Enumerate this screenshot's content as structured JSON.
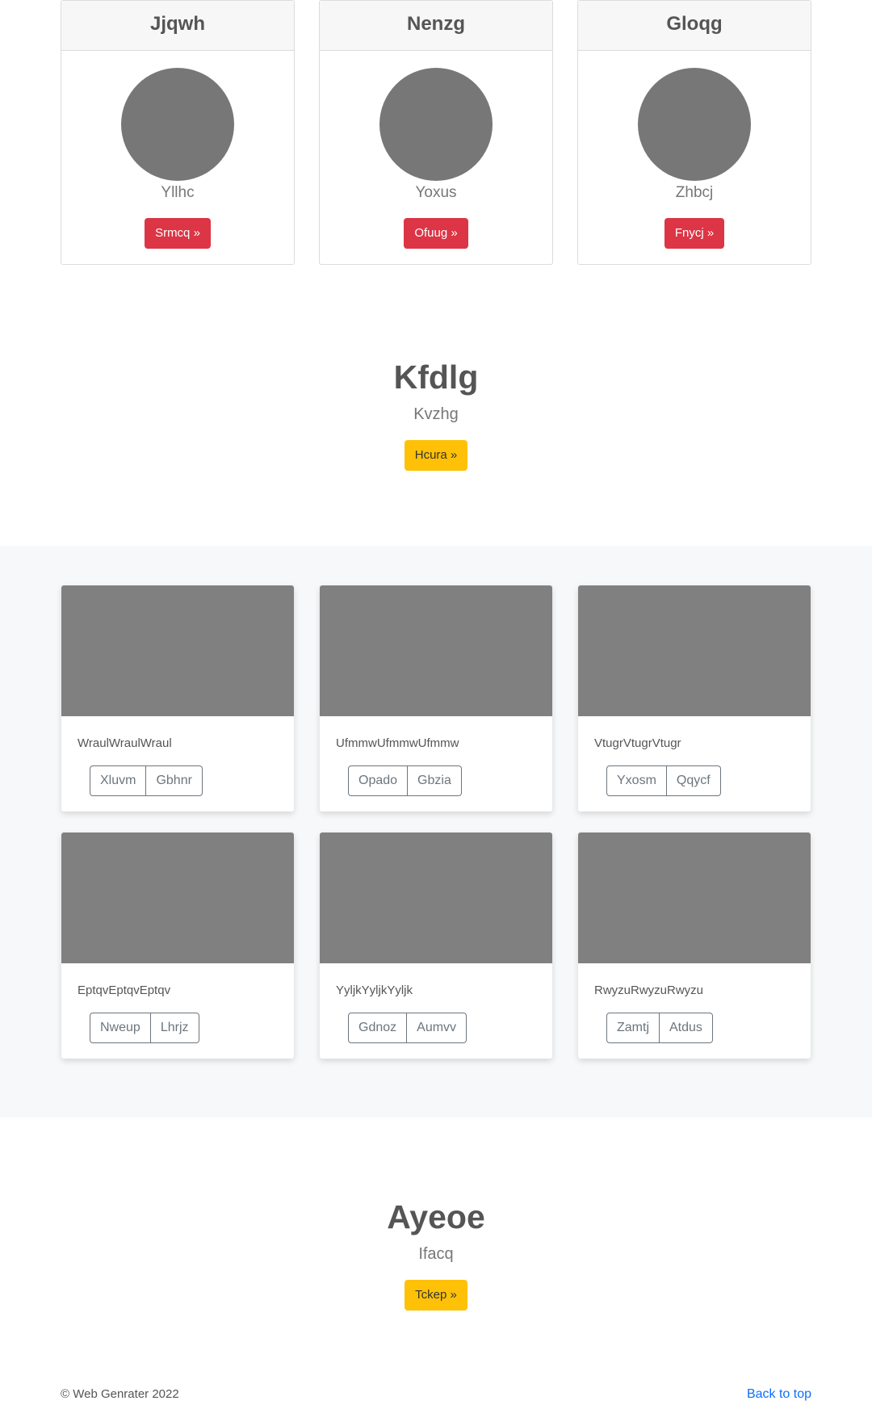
{
  "profiles": [
    {
      "header": "Jjqwh",
      "name": "Yllhc",
      "button": "Srmcq »"
    },
    {
      "header": "Nenzg",
      "name": "Yoxus",
      "button": "Ofuug »"
    },
    {
      "header": "Gloqg",
      "name": "Zhbcj",
      "button": "Fnycj »"
    }
  ],
  "hero1": {
    "title": "Kfdlg",
    "subtitle": "Kvzhg",
    "button": "Hcura »"
  },
  "gallery": [
    {
      "text": "WraulWraulWraul",
      "btn1": "Xluvm",
      "btn2": "Gbhnr"
    },
    {
      "text": "UfmmwUfmmwUfmmw",
      "btn1": "Opado",
      "btn2": "Gbzia"
    },
    {
      "text": "VtugrVtugrVtugr",
      "btn1": "Yxosm",
      "btn2": "Qqycf"
    },
    {
      "text": "EptqvEptqvEptqv",
      "btn1": "Nweup",
      "btn2": "Lhrjz"
    },
    {
      "text": "YyljkYyljkYyljk",
      "btn1": "Gdnoz",
      "btn2": "Aumvv"
    },
    {
      "text": "RwyzuRwyzuRwyzu",
      "btn1": "Zamtj",
      "btn2": "Atdus"
    }
  ],
  "hero2": {
    "title": "Ayeoe",
    "subtitle": "Ifacq",
    "button": "Tckep »"
  },
  "footer": {
    "copyright": "© Web Genrater 2022",
    "back_to_top": "Back to top"
  },
  "colors": {
    "danger": "#dc3545",
    "warning": "#ffc107",
    "link": "#0d6efd",
    "placeholder": "#808080"
  }
}
